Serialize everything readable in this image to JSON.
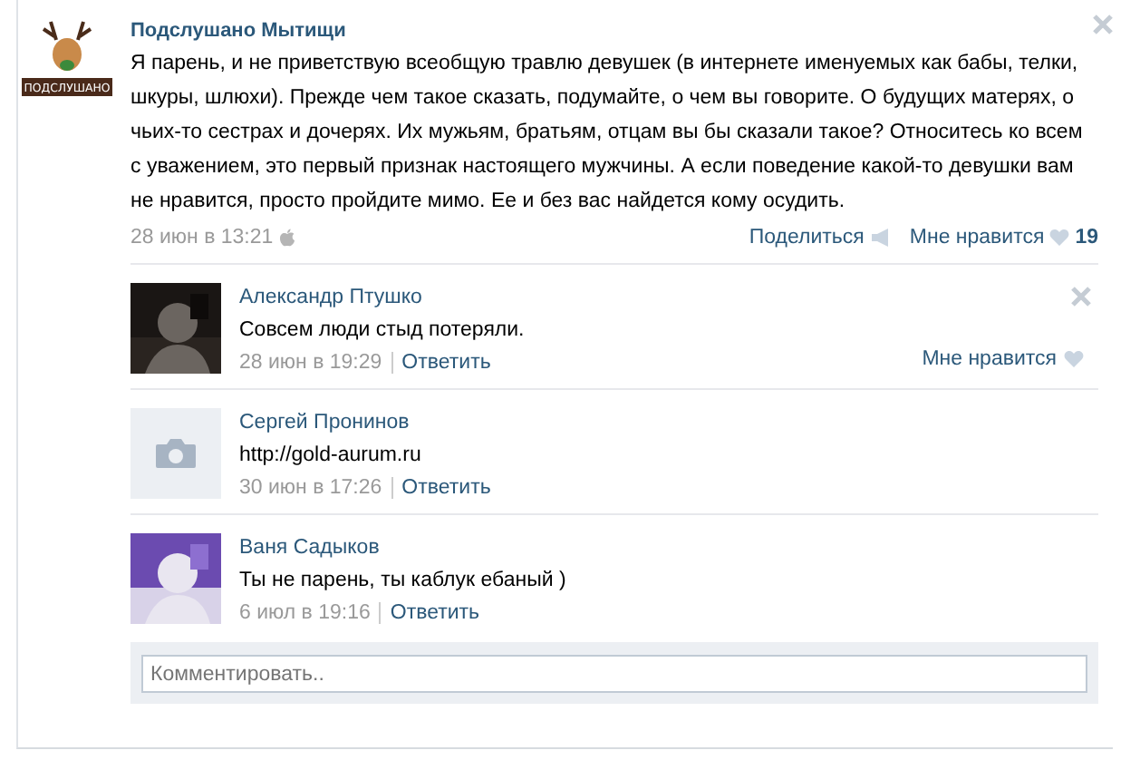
{
  "post": {
    "author": "Подслушано Мытищи",
    "avatar_label": "ПОДСЛУШАНО",
    "text": "Я парень, и не приветствую всеобщую травлю девушек (в интернете именуемых как бабы, телки, шкуры, шлюхи). Прежде чем такое сказать, подумайте, о чем вы говорите. О будущих матерях, о чьих-то сестрах и дочерях. Их мужьям, братьям, отцам вы бы сказали такое? Относитесь ко всем с уважением, это первый признак настоящего мужчины. А если поведение какой-то девушки вам не нравится, просто пройдите мимо. Ее и без вас найдется кому осудить.",
    "time": "28 июн в 13:21",
    "share": "Поделиться",
    "like": "Мне нравится",
    "like_count": "19"
  },
  "comments": [
    {
      "author": "Александр Птушко",
      "text": "Совсем люди стыд потеряли.",
      "time": "28 июн в 19:29",
      "reply": "Ответить",
      "like": "Мне нравится"
    },
    {
      "kind": "placeholder",
      "author": "Сергей Пронинов",
      "text": "http://gold-aurum.ru",
      "time": "30 июн в 17:26",
      "reply": "Ответить"
    },
    {
      "author": "Ваня Садыков",
      "text": "Ты не парень, ты каблук ебаный )",
      "time": "6 июл в 19:16",
      "reply": "Ответить"
    }
  ],
  "comment_box": {
    "placeholder": "Комментировать.."
  }
}
